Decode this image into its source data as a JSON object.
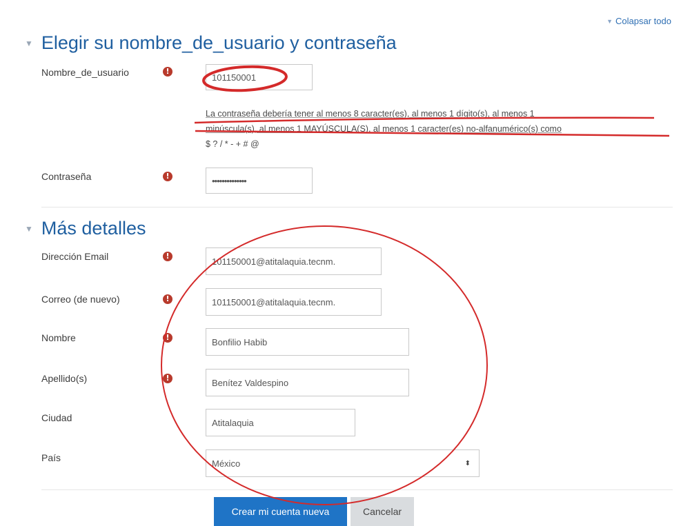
{
  "collapse_all_label": "Colapsar todo",
  "sections": {
    "account": {
      "title": "Elegir su nombre_de_usuario y contraseña"
    },
    "details": {
      "title": "Más detalles"
    }
  },
  "fields": {
    "username": {
      "label": "Nombre_de_usuario",
      "value": "101150001"
    },
    "password_help": {
      "line1": "La contraseña debería tener al menos 8 caracter(es), al menos 1 dígito(s), al menos 1",
      "line2": "minúscula(s), al menos 1 MAYÚSCULA(S), al menos 1 caracter(es) no-alfanumérico(s) como",
      "line3": "$ ? / * - + # @"
    },
    "password": {
      "label": "Contraseña",
      "value": "••••••••••••••"
    },
    "email": {
      "label": "Dirección Email",
      "value": "101150001@atitalaquia.tecnm."
    },
    "email2": {
      "label": "Correo (de nuevo)",
      "value": "101150001@atitalaquia.tecnm."
    },
    "firstname": {
      "label": "Nombre",
      "value": "Bonfilio Habib"
    },
    "lastname": {
      "label": "Apellido(s)",
      "value": "Benítez Valdespino"
    },
    "city": {
      "label": "Ciudad",
      "value": "Atitalaquia"
    },
    "country": {
      "label": "País",
      "value": "México"
    }
  },
  "buttons": {
    "submit": "Crear mi cuenta nueva",
    "cancel": "Cancelar"
  },
  "required_icon": "!",
  "annotation_color": "#d42a2a"
}
